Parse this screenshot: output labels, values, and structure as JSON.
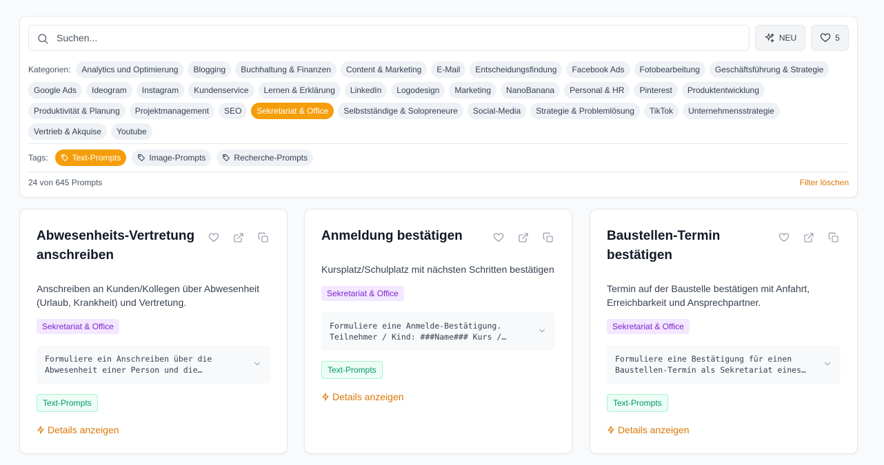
{
  "search": {
    "placeholder": "Suchen..."
  },
  "toolbar": {
    "new_label": "NEU",
    "favorites_count": "5"
  },
  "categories": {
    "label": "Kategorien:",
    "rows": [
      [
        "Analytics und Optimierung",
        "Blogging",
        "Buchhaltung & Finanzen",
        "Content & Marketing",
        "E-Mail",
        "Entscheidungsfindung",
        "Facebook Ads",
        "Fotobearbeitung",
        "Geschäftsführung & Strategie"
      ],
      [
        "Google Ads",
        "Ideogram",
        "Instagram",
        "Kundenservice",
        "Lernen & Erklärung",
        "LinkedIn",
        "Logodesign",
        "Marketing",
        "NanoBanana",
        "Personal & HR",
        "Pinterest",
        "Produktentwicklung"
      ],
      [
        "Produktivität & Planung",
        "Projektmanagement",
        "SEO",
        "Sekretariat & Office",
        "Selbstständige & Solopreneure",
        "Social-Media",
        "Strategie & Problemlösung",
        "TikTok",
        "Unternehmensstrategie"
      ],
      [
        "Vertrieb & Akquise",
        "Youtube"
      ]
    ],
    "active": "Sekretariat & Office"
  },
  "tags": {
    "label": "Tags:",
    "items": [
      "Text-Prompts",
      "Image-Prompts",
      "Recherche-Prompts"
    ],
    "active": "Text-Prompts"
  },
  "status": {
    "count_text": "24 von 645 Prompts",
    "clear_label": "Filter löschen"
  },
  "cards": [
    {
      "title": "Abwesenheits-Vertretung anschreiben",
      "description": "Anschreiben an Kunden/Kollegen über Abwesenheit (Urlaub, Krankheit) und Vertretung.",
      "category": "Sekretariat & Office",
      "prompt_preview": "Formuliere ein Anschreiben über die Abwesenheit einer Person und die Vertretung.",
      "type": "Text-Prompts",
      "details_label": "Details anzeigen"
    },
    {
      "title": "Anmeldung bestätigen",
      "description": "Kursplatz/Schulplatz mit nächsten Schritten bestätigen",
      "category": "Sekretariat & Office",
      "prompt_preview": "Formuliere eine Anmelde-Bestätigung. Teilnehmer / Kind: ###Name### Kurs / Schule",
      "type": "Text-Prompts",
      "details_label": "Details anzeigen"
    },
    {
      "title": "Baustellen-Termin bestätigen",
      "description": "Termin auf der Baustelle bestätigen mit Anfahrt, Erreichbarkeit und Ansprechpartner.",
      "category": "Sekretariat & Office",
      "prompt_preview": "Formuliere eine Bestätigung für einen Baustellen-Termin als Sekretariat eines Betriebs.",
      "type": "Text-Prompts",
      "details_label": "Details anzeigen"
    }
  ],
  "colors": {
    "accent": "#f59e0b",
    "accent_text": "#d97706",
    "category_badge": "#7e22ce",
    "type_badge": "#059669"
  }
}
